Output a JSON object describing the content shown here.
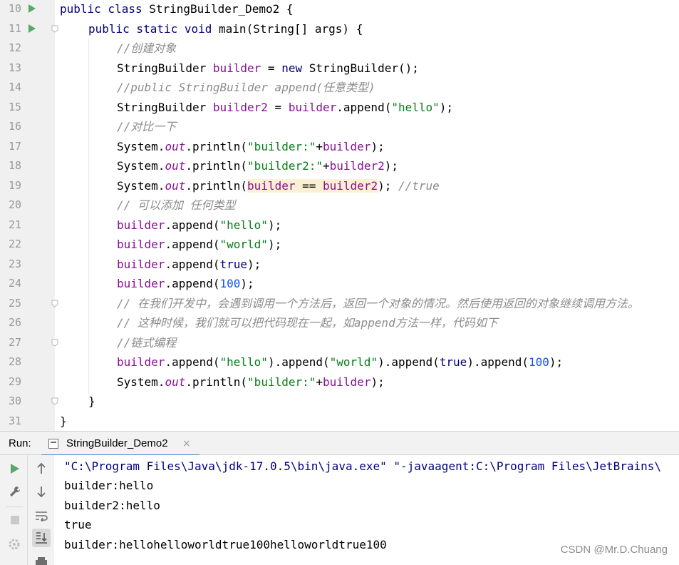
{
  "editor": {
    "lines": [
      {
        "num": "10",
        "run": true,
        "fold": false,
        "indent": 0,
        "tokens": [
          [
            "kw",
            "public class "
          ],
          [
            "plain",
            "StringBuilder_Demo2 {"
          ]
        ]
      },
      {
        "num": "11",
        "run": true,
        "fold": true,
        "indent": 1,
        "tokens": [
          [
            "kw",
            "public static void "
          ],
          [
            "plain",
            "main(String[] args) {"
          ]
        ]
      },
      {
        "num": "12",
        "run": false,
        "fold": false,
        "indent": 2,
        "tokens": [
          [
            "cmt",
            "//创建对象"
          ]
        ]
      },
      {
        "num": "13",
        "run": false,
        "fold": false,
        "indent": 2,
        "tokens": [
          [
            "plain",
            "StringBuilder "
          ],
          [
            "var",
            "builder"
          ],
          [
            "plain",
            " = "
          ],
          [
            "kw",
            "new "
          ],
          [
            "plain",
            "StringBuilder();"
          ]
        ]
      },
      {
        "num": "14",
        "run": false,
        "fold": false,
        "indent": 2,
        "tokens": [
          [
            "cmt",
            "//public StringBuilder append(任意类型)"
          ]
        ]
      },
      {
        "num": "15",
        "run": false,
        "fold": false,
        "indent": 2,
        "tokens": [
          [
            "plain",
            "StringBuilder "
          ],
          [
            "var",
            "builder2"
          ],
          [
            "plain",
            " = "
          ],
          [
            "var",
            "builder"
          ],
          [
            "plain",
            ".append("
          ],
          [
            "str",
            "\"hello\""
          ],
          [
            "plain",
            ");"
          ]
        ]
      },
      {
        "num": "16",
        "run": false,
        "fold": false,
        "indent": 2,
        "tokens": [
          [
            "cmt",
            "//对比一下"
          ]
        ]
      },
      {
        "num": "17",
        "run": false,
        "fold": false,
        "indent": 2,
        "tokens": [
          [
            "plain",
            "System."
          ],
          [
            "fld",
            "out"
          ],
          [
            "plain",
            ".println("
          ],
          [
            "str",
            "\"builder:\""
          ],
          [
            "plain",
            "+"
          ],
          [
            "var",
            "builder"
          ],
          [
            "plain",
            ");"
          ]
        ]
      },
      {
        "num": "18",
        "run": false,
        "fold": false,
        "indent": 2,
        "tokens": [
          [
            "plain",
            "System."
          ],
          [
            "fld",
            "out"
          ],
          [
            "plain",
            ".println("
          ],
          [
            "str",
            "\"builder2:\""
          ],
          [
            "plain",
            "+"
          ],
          [
            "var",
            "builder2"
          ],
          [
            "plain",
            ");"
          ]
        ]
      },
      {
        "num": "19",
        "run": false,
        "fold": false,
        "indent": 2,
        "tokens": [
          [
            "plain",
            "System."
          ],
          [
            "fld",
            "out"
          ],
          [
            "plain",
            ".println("
          ],
          [
            "hlvar",
            "builder"
          ],
          [
            "hl",
            " == "
          ],
          [
            "hlvar",
            "builder2"
          ],
          [
            "plain",
            "); "
          ],
          [
            "cmt",
            "//true"
          ]
        ]
      },
      {
        "num": "20",
        "run": false,
        "fold": false,
        "indent": 2,
        "tokens": [
          [
            "cmt",
            "// 可以添加 任何类型"
          ]
        ]
      },
      {
        "num": "21",
        "run": false,
        "fold": false,
        "indent": 2,
        "tokens": [
          [
            "var",
            "builder"
          ],
          [
            "plain",
            ".append("
          ],
          [
            "str",
            "\"hello\""
          ],
          [
            "plain",
            ");"
          ]
        ]
      },
      {
        "num": "22",
        "run": false,
        "fold": false,
        "indent": 2,
        "tokens": [
          [
            "var",
            "builder"
          ],
          [
            "plain",
            ".append("
          ],
          [
            "str",
            "\"world\""
          ],
          [
            "plain",
            ");"
          ]
        ]
      },
      {
        "num": "23",
        "run": false,
        "fold": false,
        "indent": 2,
        "tokens": [
          [
            "var",
            "builder"
          ],
          [
            "plain",
            ".append("
          ],
          [
            "kw",
            "true"
          ],
          [
            "plain",
            ");"
          ]
        ]
      },
      {
        "num": "24",
        "run": false,
        "fold": false,
        "indent": 2,
        "tokens": [
          [
            "var",
            "builder"
          ],
          [
            "plain",
            ".append("
          ],
          [
            "num",
            "100"
          ],
          [
            "plain",
            ");"
          ]
        ]
      },
      {
        "num": "25",
        "run": false,
        "fold": true,
        "indent": 2,
        "tokens": [
          [
            "cmt",
            "// 在我们开发中，会遇到调用一个方法后，返回一个对象的情况。然后使用返回的对象继续调用方法。"
          ]
        ]
      },
      {
        "num": "26",
        "run": false,
        "fold": false,
        "indent": 2,
        "tokens": [
          [
            "cmt",
            "// 这种时候，我们就可以把代码现在一起，如append方法一样，代码如下"
          ]
        ]
      },
      {
        "num": "27",
        "run": false,
        "fold": true,
        "indent": 2,
        "tokens": [
          [
            "cmt",
            "//链式编程"
          ]
        ]
      },
      {
        "num": "28",
        "run": false,
        "fold": false,
        "indent": 2,
        "tokens": [
          [
            "var",
            "builder"
          ],
          [
            "plain",
            ".append("
          ],
          [
            "str",
            "\"hello\""
          ],
          [
            "plain",
            ").append("
          ],
          [
            "str",
            "\"world\""
          ],
          [
            "plain",
            ").append("
          ],
          [
            "kw",
            "true"
          ],
          [
            "plain",
            ").append("
          ],
          [
            "num",
            "100"
          ],
          [
            "plain",
            ");"
          ]
        ]
      },
      {
        "num": "29",
        "run": false,
        "fold": false,
        "indent": 2,
        "tokens": [
          [
            "plain",
            "System."
          ],
          [
            "fld",
            "out"
          ],
          [
            "plain",
            ".println("
          ],
          [
            "str",
            "\"builder:\""
          ],
          [
            "plain",
            "+"
          ],
          [
            "var",
            "builder"
          ],
          [
            "plain",
            ");"
          ]
        ]
      },
      {
        "num": "30",
        "run": false,
        "fold": true,
        "indent": 1,
        "tokens": [
          [
            "plain",
            "}"
          ]
        ]
      },
      {
        "num": "31",
        "run": false,
        "fold": false,
        "indent": 0,
        "tokens": [
          [
            "plain",
            "}"
          ]
        ]
      }
    ]
  },
  "run_panel": {
    "label": "Run:",
    "tab_title": "StringBuilder_Demo2",
    "tab_close": "×",
    "toolbar_left": [
      "rerun-icon",
      "wrench-icon",
      "stop-icon",
      "settings-icon"
    ],
    "toolbar_right": [
      "arrow-up-icon",
      "arrow-down-icon",
      "soft-wrap-icon",
      "scroll-to-end-icon",
      "print-icon"
    ],
    "output": [
      "\"C:\\Program Files\\Java\\jdk-17.0.5\\bin\\java.exe\" \"-javaagent:C:\\Program Files\\JetBrains\\",
      "builder:hello",
      "builder2:hello",
      "true",
      "builder:hellohelloworldtrue100helloworldtrue100"
    ]
  },
  "watermark": "CSDN @Mr.D.Chuang",
  "colors": {
    "keyword": "#000080",
    "string": "#067d17",
    "variable": "#871094",
    "number": "#1750eb",
    "comment": "#8c8c8c",
    "run_icon": "#59a869",
    "tab_underline": "#4083c9",
    "highlight": "#fcf0d2"
  }
}
